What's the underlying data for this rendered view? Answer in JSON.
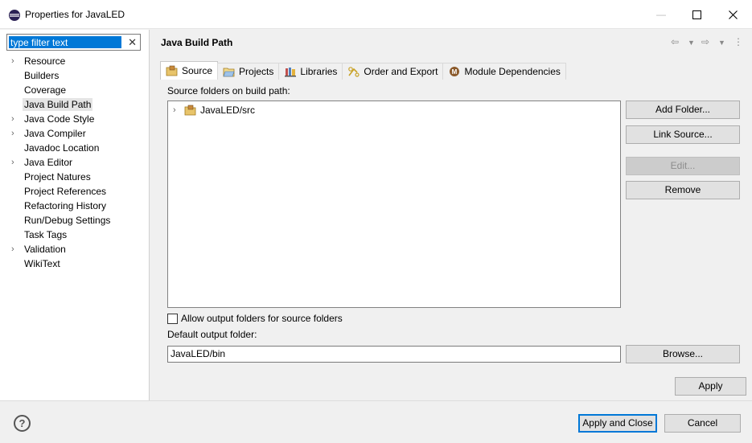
{
  "window": {
    "title": "Properties for JavaLED",
    "controls": {
      "minimize": "—",
      "maximize": "☐",
      "close": "✕"
    }
  },
  "filter": {
    "value": "type filter text",
    "clear": "✕"
  },
  "tree": {
    "items": [
      {
        "label": "Resource",
        "expandable": true
      },
      {
        "label": "Builders",
        "expandable": false
      },
      {
        "label": "Coverage",
        "expandable": false
      },
      {
        "label": "Java Build Path",
        "expandable": false,
        "selected": true
      },
      {
        "label": "Java Code Style",
        "expandable": true
      },
      {
        "label": "Java Compiler",
        "expandable": true
      },
      {
        "label": "Javadoc Location",
        "expandable": false
      },
      {
        "label": "Java Editor",
        "expandable": true
      },
      {
        "label": "Project Natures",
        "expandable": false
      },
      {
        "label": "Project References",
        "expandable": false
      },
      {
        "label": "Refactoring History",
        "expandable": false
      },
      {
        "label": "Run/Debug Settings",
        "expandable": false
      },
      {
        "label": "Task Tags",
        "expandable": false
      },
      {
        "label": "Validation",
        "expandable": true
      },
      {
        "label": "WikiText",
        "expandable": false
      }
    ]
  },
  "page": {
    "title": "Java Build Path",
    "tabs": [
      {
        "label": "Source",
        "icon": "source-folder-icon",
        "active": true
      },
      {
        "label": "Projects",
        "icon": "projects-folder-icon"
      },
      {
        "label": "Libraries",
        "icon": "libraries-icon"
      },
      {
        "label": "Order and Export",
        "icon": "order-export-icon"
      },
      {
        "label": "Module Dependencies",
        "icon": "module-icon"
      }
    ],
    "source_label": "Source folders on build path:",
    "source_folders": [
      "JavaLED/src"
    ],
    "buttons": {
      "add_folder": "Add Folder...",
      "link_source": "Link Source...",
      "edit": "Edit...",
      "remove": "Remove",
      "browse": "Browse..."
    },
    "allow_output_label": "Allow output folders for source folders",
    "default_output_label": "Default output folder:",
    "default_output_value": "JavaLED/bin",
    "apply": "Apply"
  },
  "footer": {
    "apply_close": "Apply and Close",
    "cancel": "Cancel",
    "help": "?"
  },
  "colors": {
    "accent": "#0078d7",
    "selection": "#e5e5e5"
  }
}
